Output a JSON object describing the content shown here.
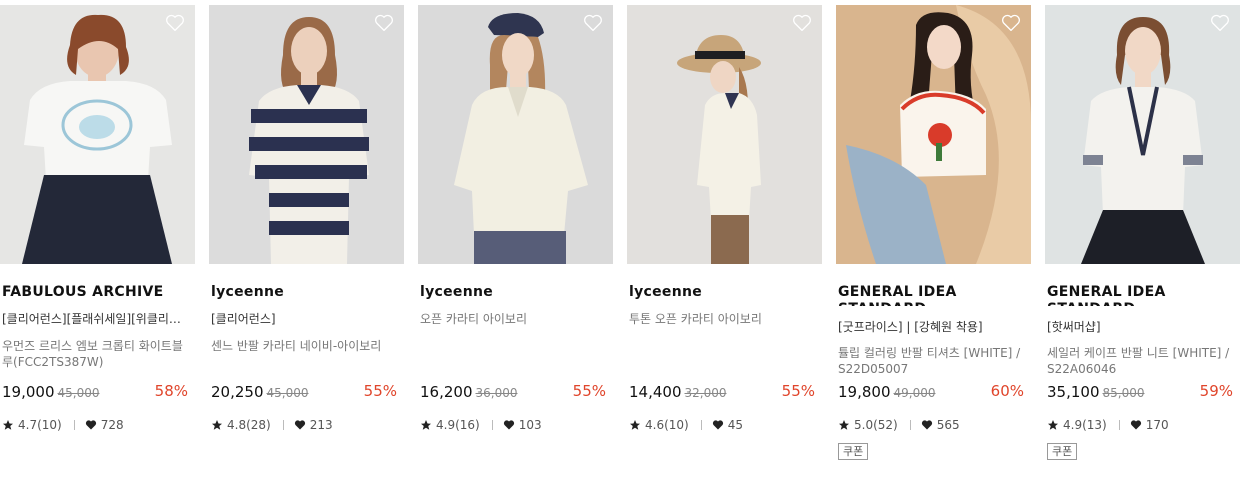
{
  "products": [
    {
      "brand": "FABULOUS ARCHIVE",
      "tags": "[클리어런스][플래쉬세일][위클리…",
      "name": "우먼즈 르리스 엠보 크롭티 화이트블루(FCC2TS387W)",
      "price": "19,000",
      "original_price": "45,000",
      "discount": "58%",
      "rating": "4.7(10)",
      "likes": "728",
      "coupon": ""
    },
    {
      "brand": "lyceenne",
      "tags": "[클리어런스]",
      "name": "센느 반팔 카라티 네이비-아이보리",
      "price": "20,250",
      "original_price": "45,000",
      "discount": "55%",
      "rating": "4.8(28)",
      "likes": "213",
      "coupon": ""
    },
    {
      "brand": "lyceenne",
      "tags": "",
      "name": "오픈 카라티 아이보리",
      "price": "16,200",
      "original_price": "36,000",
      "discount": "55%",
      "rating": "4.9(16)",
      "likes": "103",
      "coupon": ""
    },
    {
      "brand": "lyceenne",
      "tags": "",
      "name": "투톤 오픈 카라티 아이보리",
      "price": "14,400",
      "original_price": "32,000",
      "discount": "55%",
      "rating": "4.6(10)",
      "likes": "45",
      "coupon": ""
    },
    {
      "brand": "GENERAL IDEA STANDARD",
      "tags": "[굿프라이스] | [강혜원 착용]",
      "name": "튤립 컬러링 반팔 티셔츠 [WHITE] / S22D05007",
      "price": "19,800",
      "original_price": "49,000",
      "discount": "60%",
      "rating": "5.0(52)",
      "likes": "565",
      "coupon": "쿠폰"
    },
    {
      "brand": "GENERAL IDEA STANDARD",
      "tags": "[핫써머샵]",
      "name": "세일러 케이프 반팔 니트 [WHITE] / S22A06046",
      "price": "35,100",
      "original_price": "85,000",
      "discount": "59%",
      "rating": "4.9(13)",
      "likes": "170",
      "coupon": "쿠폰"
    }
  ],
  "colors": {
    "discount": "#e0452b",
    "price": "#111111",
    "original_price": "#888888",
    "meta": "#555555"
  },
  "icons": {
    "wishlist": "heart-outline-icon",
    "rating": "star-icon",
    "likes": "heart-filled-icon"
  }
}
